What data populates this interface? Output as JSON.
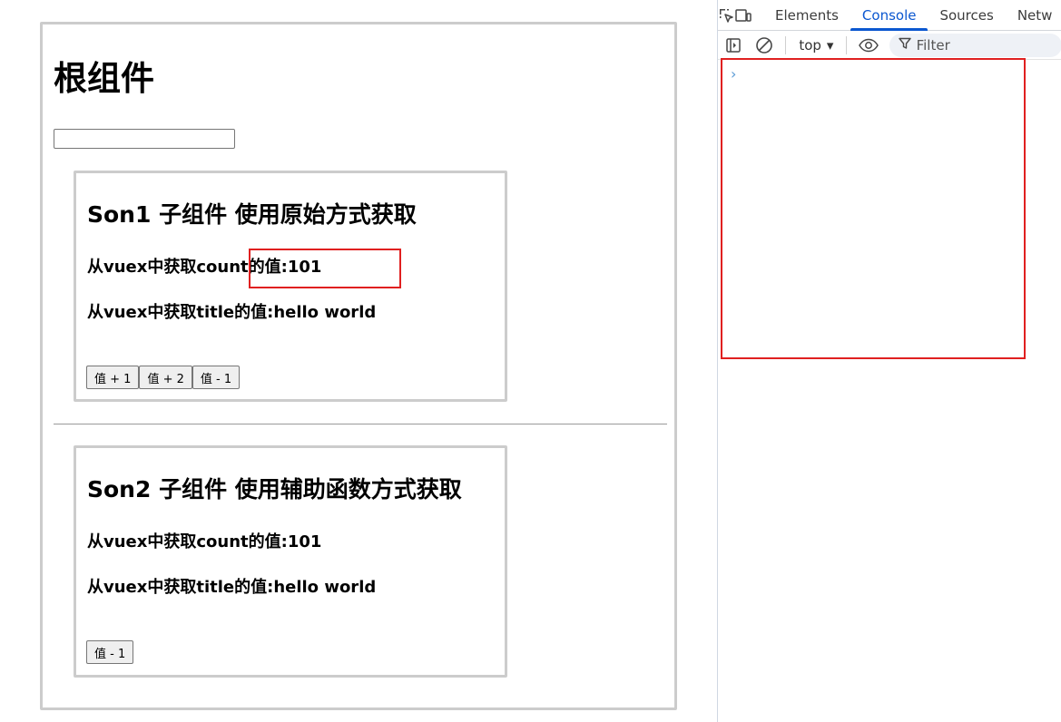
{
  "root": {
    "title": "根组件",
    "input_value": ""
  },
  "son1": {
    "title": "Son1 子组件 使用原始方式获取",
    "count_line": "从vuex中获取count的值:101",
    "title_line": "从vuex中获取title的值:hello world",
    "buttons": [
      "值 + 1",
      "值 + 2",
      "值 - 1"
    ]
  },
  "son2": {
    "title": "Son2 子组件 使用辅助函数方式获取",
    "count_line": "从vuex中获取count的值:101",
    "title_line": "从vuex中获取title的值:hello world",
    "buttons": [
      "值 - 1"
    ]
  },
  "devtools": {
    "tabs": [
      "Elements",
      "Console",
      "Sources",
      "Netw"
    ],
    "active_tab": "Console",
    "context": "top",
    "filter_placeholder": "Filter",
    "prompt_symbol": "›",
    "accent_color": "#0b57d0"
  },
  "annotations": {
    "color": "#e02020"
  }
}
